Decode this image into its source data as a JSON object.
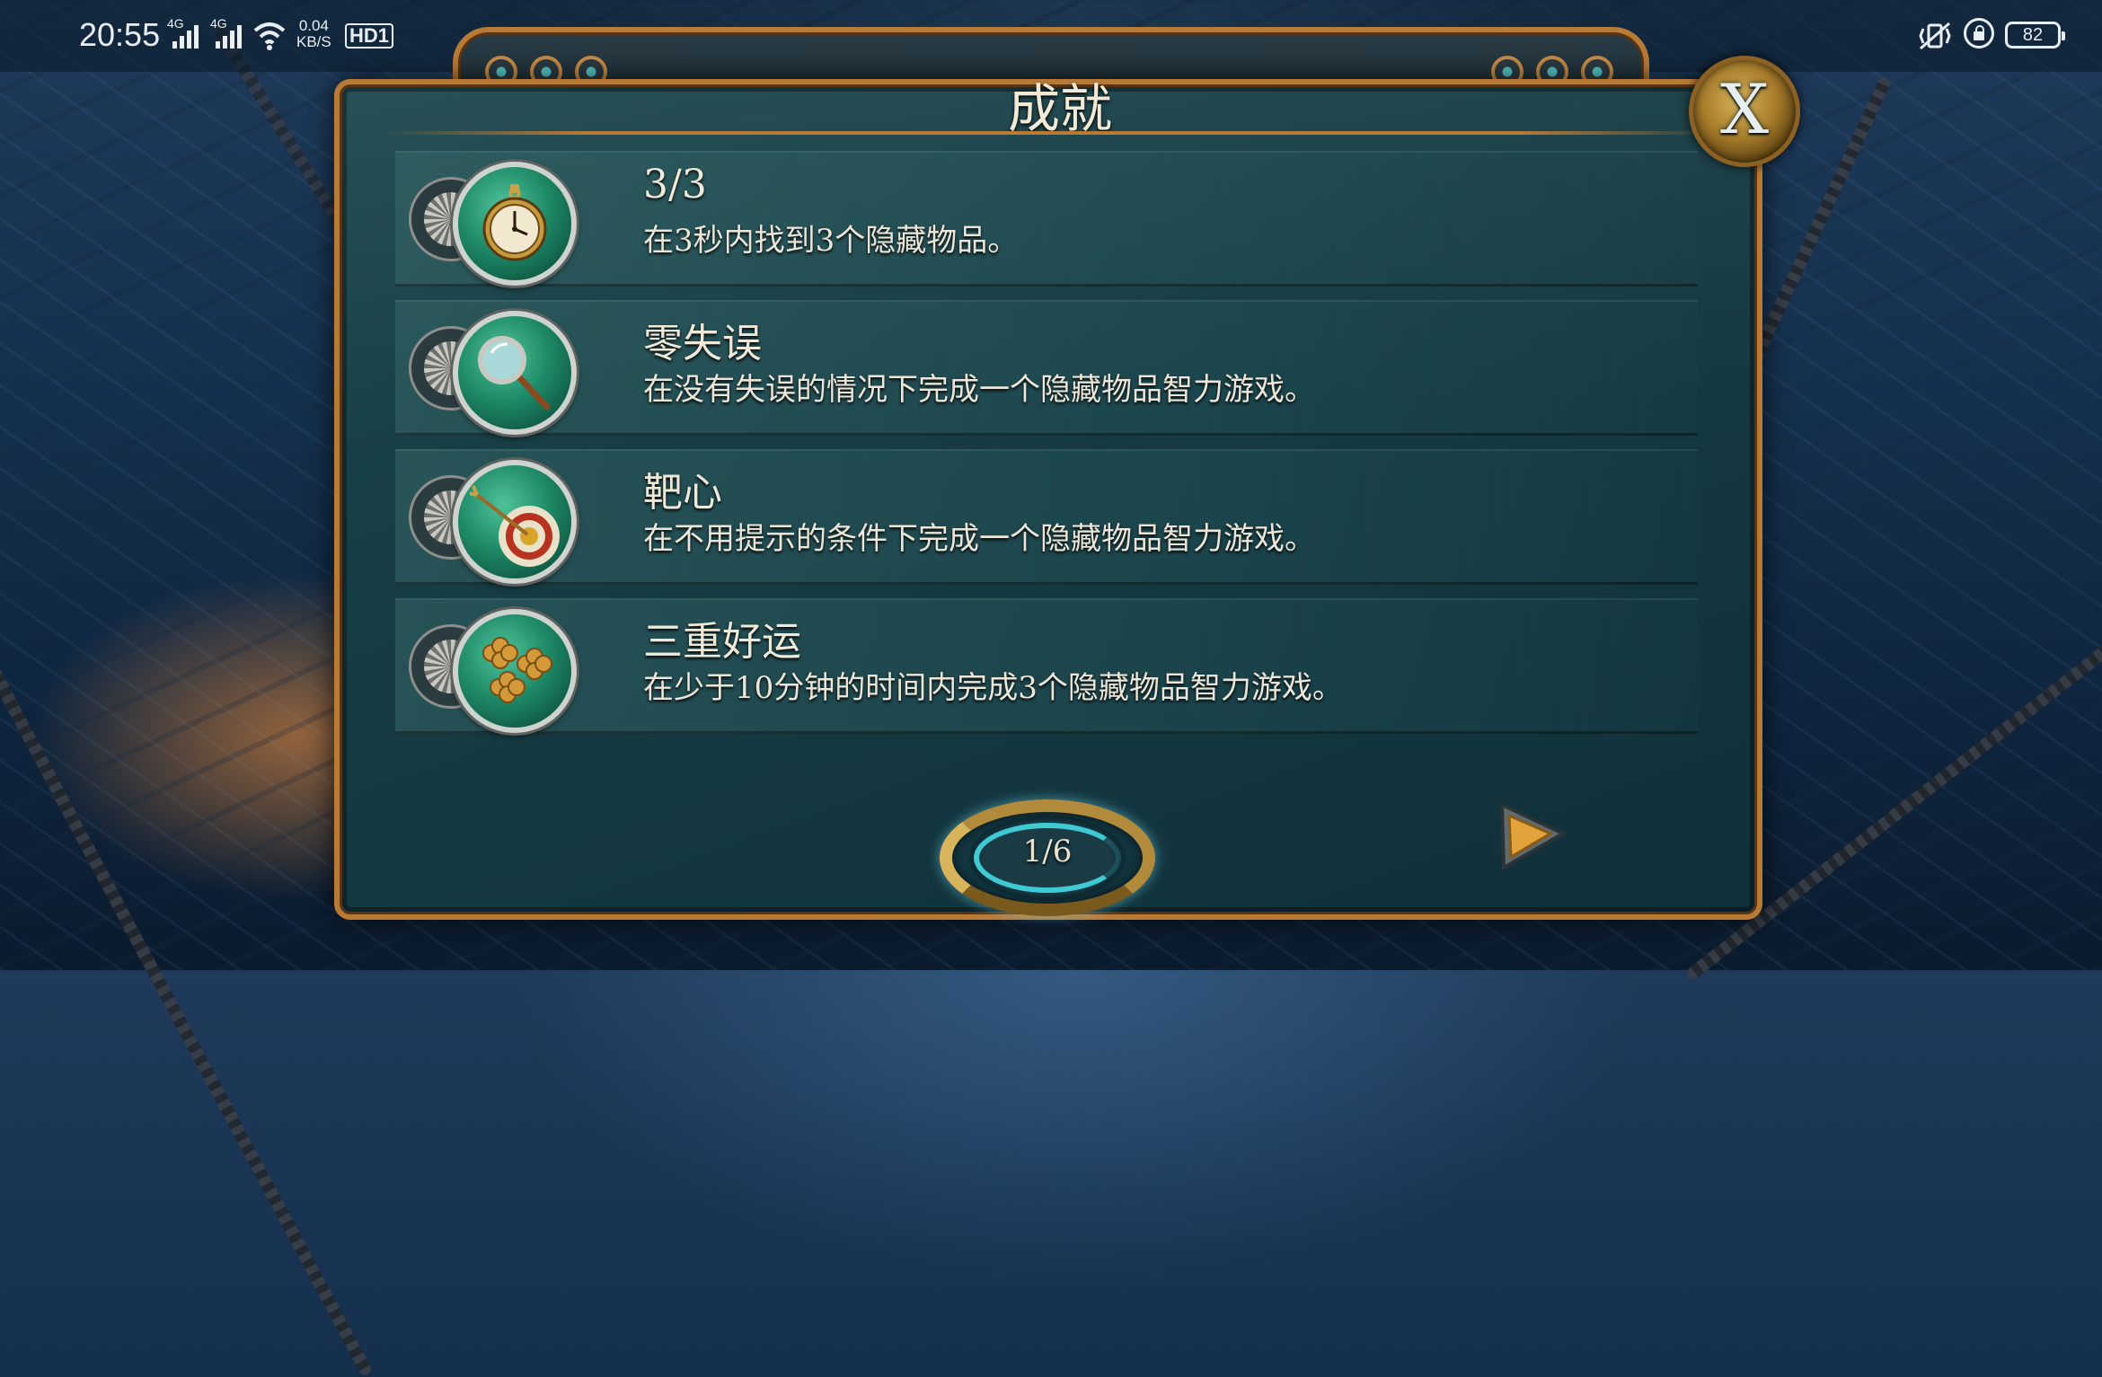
{
  "status_bar": {
    "time": "20:55",
    "net1": "4G",
    "net2": "4G",
    "speed_value": "0.04",
    "speed_unit": "KB/S",
    "hd": "HD1",
    "battery": "82"
  },
  "dialog": {
    "title": "成就",
    "close_label": "X",
    "page_indicator": "1/6"
  },
  "achievements": [
    {
      "title": "3/3",
      "description": "在3秒内找到3个隐藏物品。",
      "icon": "pocket-watch-icon"
    },
    {
      "title": "零失误",
      "description": "在没有失误的情况下完成一个隐藏物品智力游戏。",
      "icon": "magnifying-glass-icon"
    },
    {
      "title": "靶心",
      "description": "在不用提示的条件下完成一个隐藏物品智力游戏。",
      "icon": "target-arrow-icon"
    },
    {
      "title": "三重好运",
      "description": "在少于10分钟的时间内完成3个隐藏物品智力游戏。",
      "icon": "clover-icon"
    }
  ],
  "colors": {
    "frame_gold": "#b97a36",
    "panel_teal": "#163c44",
    "medal_green": "#1f8a68",
    "text_cream": "#efe9d9"
  }
}
